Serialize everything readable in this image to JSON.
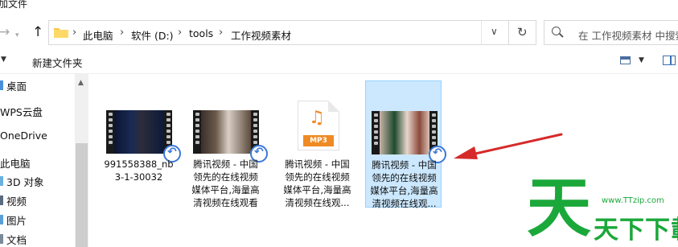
{
  "window": {
    "title_fragment": "加文件"
  },
  "navigation": {
    "back_icon": "back-arrow-icon",
    "forward_icon": "forward-arrow-icon",
    "up_icon": "up-arrow-icon",
    "breadcrumb": [
      "此电脑",
      "软件 (D:)",
      "tools",
      "工作视频素材"
    ],
    "search_placeholder": "在 工作视频素材 中搜索"
  },
  "toolbar": {
    "new_folder_label": "新建文件夹"
  },
  "sidebar": {
    "items": [
      {
        "label": "桌面",
        "icon": "desktop-icon"
      },
      {
        "label": "WPS云盘",
        "icon": "cloud-icon"
      },
      {
        "label": "OneDrive",
        "icon": "onedrive-icon"
      },
      {
        "label": "此电脑",
        "icon": "computer-icon"
      },
      {
        "label": "3D 对象",
        "icon": "3d-objects-icon"
      },
      {
        "label": "视频",
        "icon": "videos-icon"
      },
      {
        "label": "图片",
        "icon": "pictures-icon"
      },
      {
        "label": "文档",
        "icon": "documents-icon"
      }
    ]
  },
  "files": [
    {
      "name": "991558388_nb3-1-30032",
      "type": "video",
      "selected": false
    },
    {
      "name": "腾讯视频 - 中国领先的在线视频媒体平台,海量高清视频在线观看",
      "type": "video",
      "selected": false
    },
    {
      "name": "腾讯视频 - 中国领先的在线视频媒体平台,海量高清视频在线观...",
      "type": "mp3",
      "badge": "MP3",
      "selected": false
    },
    {
      "name": "腾讯视频 - 中国领先的在线视频媒体平台,海量高清视频在线观...",
      "type": "video",
      "selected": true
    }
  ],
  "watermark": {
    "big": "天",
    "url": "www.TTzip.com",
    "text": "天下下載"
  },
  "colors": {
    "accent": "#3b78d8",
    "selection": "#cce8ff",
    "watermark": "#1ba83a",
    "annotation_arrow": "#d62a2a"
  }
}
